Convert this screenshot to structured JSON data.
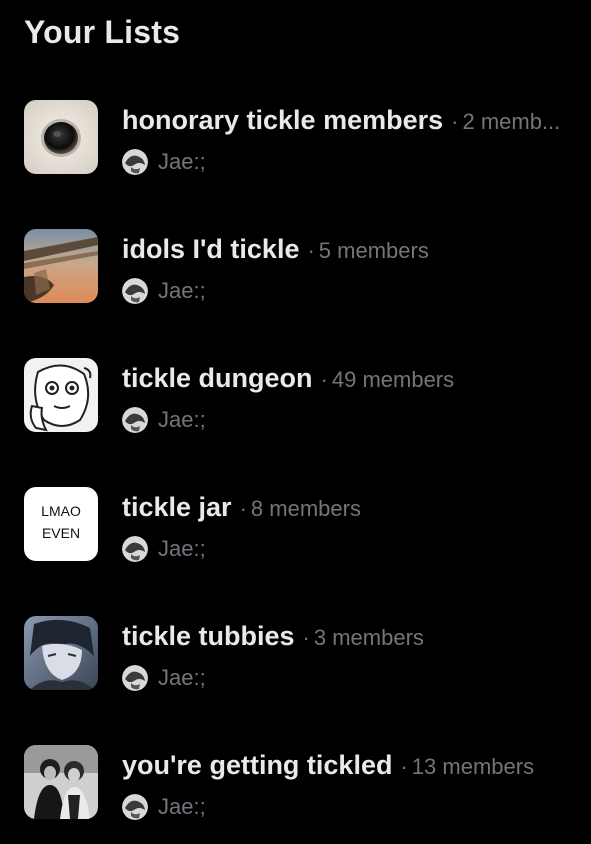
{
  "header": {
    "title": "Your Lists"
  },
  "lists": [
    {
      "name": "honorary tickle members",
      "separator": "·",
      "members": "2 memb...",
      "owner": "Jae:;",
      "thumb_icon": "eye-hole-thumbnail"
    },
    {
      "name": "idols I'd tickle",
      "separator": "·",
      "members": "5 members",
      "owner": "Jae:;",
      "thumb_icon": "sunset-scene-thumbnail"
    },
    {
      "name": "tickle dungeon",
      "separator": "·",
      "members": "49 members",
      "owner": "Jae:;",
      "thumb_icon": "cartoon-face-thumbnail"
    },
    {
      "name": "tickle jar",
      "separator": "·",
      "members": "8 members",
      "owner": "Jae:;",
      "thumb_icon": "text-thumbnail",
      "thumb_text_1": "LMAO",
      "thumb_text_2": "EVEN"
    },
    {
      "name": "tickle tubbies",
      "separator": "·",
      "members": "3 members",
      "owner": "Jae:;",
      "thumb_icon": "anime-character-thumbnail"
    },
    {
      "name": "you're getting tickled",
      "separator": "·",
      "members": "13 members",
      "owner": "Jae:;",
      "thumb_icon": "couple-photo-thumbnail"
    }
  ],
  "colors": {
    "background": "#000000",
    "primary_text": "#e7e9ea",
    "secondary_text": "#71767b"
  }
}
